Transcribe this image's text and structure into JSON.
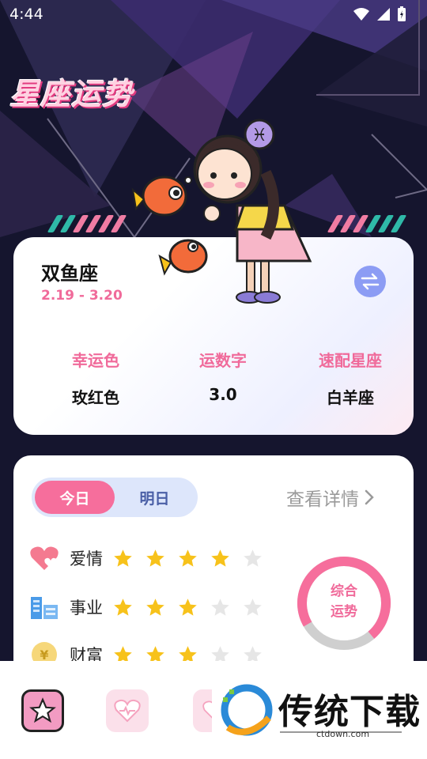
{
  "status_bar": {
    "time": "4:44"
  },
  "page": {
    "title": "星座运势"
  },
  "sign": {
    "name": "双鱼座",
    "dates": "2.19 - 3.20",
    "attributes": [
      {
        "label": "幸运色",
        "value": "玫红色"
      },
      {
        "label": "运数字",
        "value": "3.0"
      },
      {
        "label": "速配星座",
        "value": "白羊座"
      }
    ]
  },
  "fortune": {
    "tabs": [
      {
        "label": "今日",
        "active": true
      },
      {
        "label": "明日",
        "active": false
      }
    ],
    "details_label": "查看详情",
    "rows": [
      {
        "label": "爱情",
        "icon": "heart-icon",
        "stars": 4
      },
      {
        "label": "事业",
        "icon": "building-icon",
        "stars": 3
      },
      {
        "label": "财富",
        "icon": "coin-icon",
        "stars": 3
      }
    ],
    "overall_label": "综合\n运势",
    "overall_fraction": 0.72
  },
  "colors": {
    "accent": "#f66e9c",
    "star_on": "#f7c21b",
    "star_off": "#e6e6e6",
    "ring_track": "#cfcfcf"
  },
  "watermark": {
    "text": "传统下载",
    "url": "ctdown.com"
  }
}
